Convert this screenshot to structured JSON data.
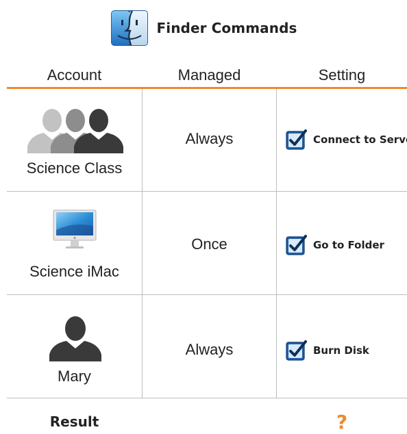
{
  "header": {
    "title": "Finder Commands",
    "icon": "finder-icon"
  },
  "table": {
    "columns": [
      "Account",
      "Managed",
      "Setting"
    ],
    "rows": [
      {
        "account": "Science Class",
        "account_icon": "group-users-icon",
        "managed": "Always",
        "setting": "Connect to Server",
        "checked": true
      },
      {
        "account": "Science iMac",
        "account_icon": "imac-computer-icon",
        "managed": "Once",
        "setting": "Go to Folder",
        "checked": true
      },
      {
        "account": "Mary",
        "account_icon": "single-user-icon",
        "managed": "Always",
        "setting": "Burn Disk",
        "checked": true
      }
    ]
  },
  "result": {
    "label": "Result",
    "value": "?"
  },
  "colors": {
    "accent": "#ef8a2e",
    "checkbox_blue": "#1f5fa8",
    "divider": "#bdbdbd"
  }
}
